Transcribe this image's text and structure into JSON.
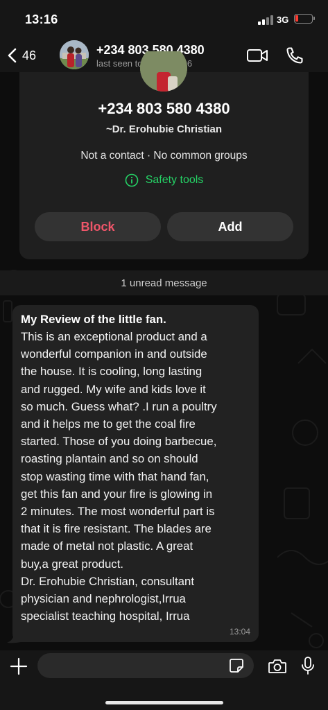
{
  "status_bar": {
    "time": "13:16",
    "network": "3G",
    "icons": [
      "signal-icon",
      "battery-icon"
    ]
  },
  "header": {
    "back_count": "46",
    "title": "+234 803 580 4380",
    "subtitle": "last seen today at 13:06",
    "icons": [
      "back-chevron-icon",
      "video-call-icon",
      "phone-call-icon"
    ]
  },
  "contact_card": {
    "phone": "+234 803 580 4380",
    "name": "~Dr. Erohubie Christian",
    "info": "Not a contact · No common groups",
    "safety_label": "Safety tools",
    "block_label": "Block",
    "add_label": "Add"
  },
  "unread_banner": "1 unread message",
  "message": {
    "title": "My Review of the little fan.",
    "body": "This is an exceptional product and a\nwonderful companion in and outside\nthe house. It is cooling, long lasting\nand rugged. My wife and kids love it\nso much. Guess what? .I run a poultry\nand it helps me to get the coal fire\nstarted. Those of you doing barbecue,\nroasting plantain and so on should\nstop wasting time with that hand fan,\nget this fan and your fire is glowing in\n2 minutes. The most wonderful part is\nthat it is fire resistant. The blades are\nmade of metal not plastic. A great\nbuy,a great product.\nDr. Erohubie Christian, consultant\nphysician and nephrologist,Irrua\nspecialist teaching hospital, Irrua",
    "time": "13:04"
  },
  "input_bar": {
    "value": "",
    "icons": [
      "plus-icon",
      "sticker-icon",
      "camera-icon",
      "microphone-icon"
    ]
  },
  "colors": {
    "accent_green": "#25d366",
    "block_red": "#f0566a",
    "battery_red": "#ff3b30",
    "bubble": "#222222"
  }
}
